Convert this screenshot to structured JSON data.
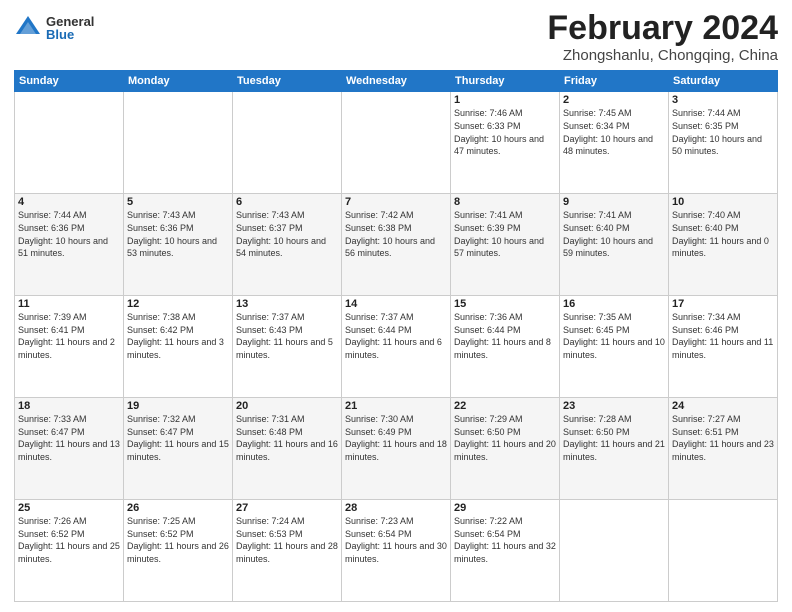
{
  "header": {
    "logo_general": "General",
    "logo_blue": "Blue",
    "title": "February 2024",
    "location": "Zhongshanlu, Chongqing, China"
  },
  "days_of_week": [
    "Sunday",
    "Monday",
    "Tuesday",
    "Wednesday",
    "Thursday",
    "Friday",
    "Saturday"
  ],
  "weeks": [
    [
      {
        "day": "",
        "sunrise": "",
        "sunset": "",
        "daylight": ""
      },
      {
        "day": "",
        "sunrise": "",
        "sunset": "",
        "daylight": ""
      },
      {
        "day": "",
        "sunrise": "",
        "sunset": "",
        "daylight": ""
      },
      {
        "day": "",
        "sunrise": "",
        "sunset": "",
        "daylight": ""
      },
      {
        "day": "1",
        "sunrise": "Sunrise: 7:46 AM",
        "sunset": "Sunset: 6:33 PM",
        "daylight": "Daylight: 10 hours and 47 minutes."
      },
      {
        "day": "2",
        "sunrise": "Sunrise: 7:45 AM",
        "sunset": "Sunset: 6:34 PM",
        "daylight": "Daylight: 10 hours and 48 minutes."
      },
      {
        "day": "3",
        "sunrise": "Sunrise: 7:44 AM",
        "sunset": "Sunset: 6:35 PM",
        "daylight": "Daylight: 10 hours and 50 minutes."
      }
    ],
    [
      {
        "day": "4",
        "sunrise": "Sunrise: 7:44 AM",
        "sunset": "Sunset: 6:36 PM",
        "daylight": "Daylight: 10 hours and 51 minutes."
      },
      {
        "day": "5",
        "sunrise": "Sunrise: 7:43 AM",
        "sunset": "Sunset: 6:36 PM",
        "daylight": "Daylight: 10 hours and 53 minutes."
      },
      {
        "day": "6",
        "sunrise": "Sunrise: 7:43 AM",
        "sunset": "Sunset: 6:37 PM",
        "daylight": "Daylight: 10 hours and 54 minutes."
      },
      {
        "day": "7",
        "sunrise": "Sunrise: 7:42 AM",
        "sunset": "Sunset: 6:38 PM",
        "daylight": "Daylight: 10 hours and 56 minutes."
      },
      {
        "day": "8",
        "sunrise": "Sunrise: 7:41 AM",
        "sunset": "Sunset: 6:39 PM",
        "daylight": "Daylight: 10 hours and 57 minutes."
      },
      {
        "day": "9",
        "sunrise": "Sunrise: 7:41 AM",
        "sunset": "Sunset: 6:40 PM",
        "daylight": "Daylight: 10 hours and 59 minutes."
      },
      {
        "day": "10",
        "sunrise": "Sunrise: 7:40 AM",
        "sunset": "Sunset: 6:40 PM",
        "daylight": "Daylight: 11 hours and 0 minutes."
      }
    ],
    [
      {
        "day": "11",
        "sunrise": "Sunrise: 7:39 AM",
        "sunset": "Sunset: 6:41 PM",
        "daylight": "Daylight: 11 hours and 2 minutes."
      },
      {
        "day": "12",
        "sunrise": "Sunrise: 7:38 AM",
        "sunset": "Sunset: 6:42 PM",
        "daylight": "Daylight: 11 hours and 3 minutes."
      },
      {
        "day": "13",
        "sunrise": "Sunrise: 7:37 AM",
        "sunset": "Sunset: 6:43 PM",
        "daylight": "Daylight: 11 hours and 5 minutes."
      },
      {
        "day": "14",
        "sunrise": "Sunrise: 7:37 AM",
        "sunset": "Sunset: 6:44 PM",
        "daylight": "Daylight: 11 hours and 6 minutes."
      },
      {
        "day": "15",
        "sunrise": "Sunrise: 7:36 AM",
        "sunset": "Sunset: 6:44 PM",
        "daylight": "Daylight: 11 hours and 8 minutes."
      },
      {
        "day": "16",
        "sunrise": "Sunrise: 7:35 AM",
        "sunset": "Sunset: 6:45 PM",
        "daylight": "Daylight: 11 hours and 10 minutes."
      },
      {
        "day": "17",
        "sunrise": "Sunrise: 7:34 AM",
        "sunset": "Sunset: 6:46 PM",
        "daylight": "Daylight: 11 hours and 11 minutes."
      }
    ],
    [
      {
        "day": "18",
        "sunrise": "Sunrise: 7:33 AM",
        "sunset": "Sunset: 6:47 PM",
        "daylight": "Daylight: 11 hours and 13 minutes."
      },
      {
        "day": "19",
        "sunrise": "Sunrise: 7:32 AM",
        "sunset": "Sunset: 6:47 PM",
        "daylight": "Daylight: 11 hours and 15 minutes."
      },
      {
        "day": "20",
        "sunrise": "Sunrise: 7:31 AM",
        "sunset": "Sunset: 6:48 PM",
        "daylight": "Daylight: 11 hours and 16 minutes."
      },
      {
        "day": "21",
        "sunrise": "Sunrise: 7:30 AM",
        "sunset": "Sunset: 6:49 PM",
        "daylight": "Daylight: 11 hours and 18 minutes."
      },
      {
        "day": "22",
        "sunrise": "Sunrise: 7:29 AM",
        "sunset": "Sunset: 6:50 PM",
        "daylight": "Daylight: 11 hours and 20 minutes."
      },
      {
        "day": "23",
        "sunrise": "Sunrise: 7:28 AM",
        "sunset": "Sunset: 6:50 PM",
        "daylight": "Daylight: 11 hours and 21 minutes."
      },
      {
        "day": "24",
        "sunrise": "Sunrise: 7:27 AM",
        "sunset": "Sunset: 6:51 PM",
        "daylight": "Daylight: 11 hours and 23 minutes."
      }
    ],
    [
      {
        "day": "25",
        "sunrise": "Sunrise: 7:26 AM",
        "sunset": "Sunset: 6:52 PM",
        "daylight": "Daylight: 11 hours and 25 minutes."
      },
      {
        "day": "26",
        "sunrise": "Sunrise: 7:25 AM",
        "sunset": "Sunset: 6:52 PM",
        "daylight": "Daylight: 11 hours and 26 minutes."
      },
      {
        "day": "27",
        "sunrise": "Sunrise: 7:24 AM",
        "sunset": "Sunset: 6:53 PM",
        "daylight": "Daylight: 11 hours and 28 minutes."
      },
      {
        "day": "28",
        "sunrise": "Sunrise: 7:23 AM",
        "sunset": "Sunset: 6:54 PM",
        "daylight": "Daylight: 11 hours and 30 minutes."
      },
      {
        "day": "29",
        "sunrise": "Sunrise: 7:22 AM",
        "sunset": "Sunset: 6:54 PM",
        "daylight": "Daylight: 11 hours and 32 minutes."
      },
      {
        "day": "",
        "sunrise": "",
        "sunset": "",
        "daylight": ""
      },
      {
        "day": "",
        "sunrise": "",
        "sunset": "",
        "daylight": ""
      }
    ]
  ]
}
